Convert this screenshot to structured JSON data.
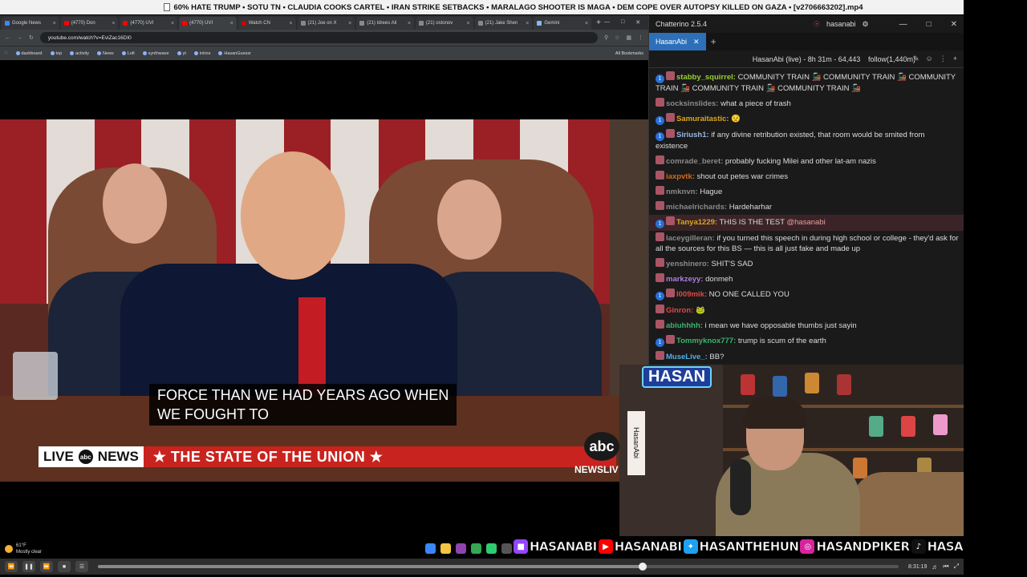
{
  "player": {
    "title": "60% HATE TRUMP • SOTU TN • CLAUDIA COOKS CARTEL • IRAN STRIKE SETBACKS • MARALAGO SHOOTER IS MAGA • DEM COPE OVER AUTOPSY KILLED ON GAZA • [v2706663202].mp4",
    "time": "8:31:19",
    "progress": 0.68
  },
  "browser": {
    "tabs": [
      {
        "label": "Google News",
        "color": "#4285f4"
      },
      {
        "label": "(4770) Don",
        "color": "#ff0000"
      },
      {
        "label": "(4770) UVI",
        "color": "#ff0000"
      },
      {
        "label": "(4770) UVI",
        "color": "#ff0000"
      },
      {
        "label": "Watch CN",
        "color": "#cc0000"
      },
      {
        "label": "(21) Joe on X",
        "color": "#888888"
      },
      {
        "label": "(21) Idrees Ali",
        "color": "#888888"
      },
      {
        "label": "(21) ostonov",
        "color": "#888888"
      },
      {
        "label": "(21) Jake Shen",
        "color": "#888888"
      },
      {
        "label": "Gemini",
        "color": "#8ab4f8"
      }
    ],
    "url": "youtube.com/watch?v=EviZac16DI0",
    "bookmarks": [
      "dashboard",
      "top",
      "activity",
      "News",
      "Lofi",
      "synthwave",
      "yt",
      "intros",
      "HasanGuessr"
    ],
    "all_bookmarks": "All Bookmarks"
  },
  "video": {
    "caption_line1": "FORCE THAN WE HAD YEARS AGO WHEN",
    "caption_line2": "WE FOUGHT TO",
    "chyron_live": "LIVE",
    "chyron_news": "NEWS",
    "chyron_title": "★ THE STATE OF THE UNION ★",
    "abc_logo": "abc",
    "newslive": "NEWSLIV"
  },
  "chat": {
    "app_title": "Chatterino 2.5.4",
    "account": "hasanabi",
    "tab": "HasanAbi",
    "status": "HasanAbi (live) - 8h 31m - 64,443",
    "follow": "follow(1,440m)",
    "messages": [
      {
        "user": "stabby_squirrel:",
        "color": "#9acd32",
        "text": "COMMUNITY TRAIN 🚂 COMMUNITY TRAIN 🚂 COMMUNITY TRAIN 🚂 COMMUNITY TRAIN 🚂 COMMUNITY TRAIN 🚂",
        "badge": true
      },
      {
        "user": "socksinslides:",
        "color": "#8a8a8a",
        "text": "what a piece of trash",
        "badge": false
      },
      {
        "user": "Samuraitastic:",
        "color": "#daa520",
        "text": "😟",
        "badge": true
      },
      {
        "user": "Siriush1:",
        "color": "#9ab8e0",
        "text": "if any divine retribution existed, that room would be smited from existence",
        "badge": true
      },
      {
        "user": "comrade_beret:",
        "color": "#8a8a8a",
        "text": "probably fucking Milei and other lat-am nazis",
        "badge": false
      },
      {
        "user": "iaxpvtk:",
        "color": "#d2691e",
        "text": "shout out petes war crimes",
        "badge": false
      },
      {
        "user": "nmknvn:",
        "color": "#8a8a8a",
        "text": "Hague",
        "badge": false
      },
      {
        "user": "michaelrichards:",
        "color": "#8a8a8a",
        "text": "Hardeharhar",
        "badge": false
      },
      {
        "user": "Tanya1229:",
        "color": "#daa520",
        "text": "THIS IS THE TEST",
        "mention": "@hasanabi",
        "badge": true,
        "highlight": true
      },
      {
        "user": "laceygilleran:",
        "color": "#8a8a8a",
        "text": "if you turned this speech in during high school or college - they'd ask for all the sources for this BS — this is all just fake and made up",
        "badge": false
      },
      {
        "user": "yenshinero:",
        "color": "#8a8a8a",
        "text": "SHIT'S SAD",
        "badge": false
      },
      {
        "user": "markzeyy:",
        "color": "#b07de0",
        "text": "donmeh",
        "badge": false
      },
      {
        "user": "l009mik:",
        "color": "#e04848",
        "text": "NO ONE CALLED YOU",
        "badge": true
      },
      {
        "user": "Ginron:",
        "color": "#e04848",
        "text": "🐸",
        "badge": false
      },
      {
        "user": "abiuhhhh:",
        "color": "#3cb371",
        "text": "i mean we have opposable thumbs just sayin",
        "badge": false
      },
      {
        "user": "Tommyknox777:",
        "color": "#3cb371",
        "text": "trump is scum of the earth",
        "badge": true
      },
      {
        "user": "MuseLive_:",
        "color": "#4fb0e8",
        "text": "BB?",
        "badge": false
      }
    ]
  },
  "cam": {
    "sign": "HASAN",
    "vertical": "HasanAbi"
  },
  "social": [
    {
      "handle": "HASANABI",
      "icon": "twitch-icon",
      "color": "#9146ff",
      "glyph": "■"
    },
    {
      "handle": "HASANABI",
      "icon": "youtube-icon",
      "color": "#ff0000",
      "glyph": "▶"
    },
    {
      "handle": "HASANTHEHUN",
      "icon": "twitter-icon",
      "color": "#1da1f2",
      "glyph": "✦"
    },
    {
      "handle": "HASANDPIKER",
      "icon": "instagram-icon",
      "color": "#d6249f",
      "glyph": "◎"
    },
    {
      "handle": "HASANDPIKER",
      "icon": "tiktok-icon",
      "color": "#111111",
      "glyph": "♪"
    }
  ],
  "weather": {
    "temp": "61°F",
    "desc": "Mostly clear"
  }
}
